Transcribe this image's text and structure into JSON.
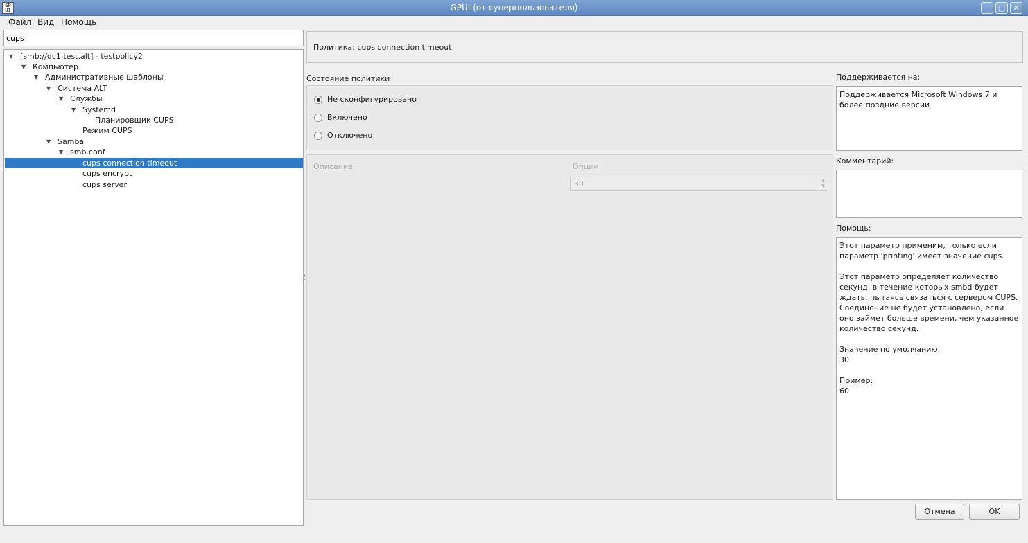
{
  "window": {
    "title": "GPUI (от суперпользователя)",
    "app_icon_text": "GP\nUI",
    "buttons": {
      "minimize": "_",
      "maximize": "□",
      "close": "✕"
    }
  },
  "menu": {
    "items": [
      {
        "first": "Ф",
        "rest": "айл"
      },
      {
        "first": "В",
        "rest": "ид"
      },
      {
        "first": "П",
        "rest": "омощь"
      }
    ]
  },
  "search": {
    "value": "cups"
  },
  "tree": {
    "rows": [
      {
        "label": "[smb://dc1.test.alt] - testpolicy2",
        "expanded": true
      },
      {
        "label": "Компьютер",
        "expanded": true
      },
      {
        "label": "Административные шаблоны",
        "expanded": true
      },
      {
        "label": "Система ALT",
        "expanded": true
      },
      {
        "label": "Службы",
        "expanded": true
      },
      {
        "label": "Systemd",
        "expanded": true
      },
      {
        "label": "Планировщик CUPS"
      },
      {
        "label": "Режим CUPS"
      },
      {
        "label": "Samba",
        "expanded": true
      },
      {
        "label": "smb.conf",
        "expanded": true
      },
      {
        "label": "cups connection timeout",
        "selected": true
      },
      {
        "label": "cups encrypt"
      },
      {
        "label": "cups server"
      }
    ]
  },
  "policy": {
    "header": "Политика: cups connection timeout",
    "state_label": "Состояние политики",
    "options": [
      {
        "label": "Не сконфигурировано",
        "checked": true
      },
      {
        "label": "Включено",
        "checked": false
      },
      {
        "label": "Отключено",
        "checked": false
      }
    ],
    "description_label": "Описание:",
    "options_label": "Опции:",
    "option_value": "30",
    "supported_label": "Поддерживается на:",
    "supported_text": "Поддерживается Microsoft Windows 7 и более поздние версии",
    "comment_label": "Комментарий:",
    "comment_value": "",
    "help_label": "Помощь:",
    "help_paragraphs": [
      "Этот параметр применим, только если параметр 'printing' имеет значение cups.",
      "Этот параметр определяет количество секунд, в течение которых smbd будет ждать, пытаясь связаться с сервером CUPS. Соединение не будет установлено, если оно займет больше времени, чем указанное количество секунд.",
      "Значение по умолчанию:\n30",
      "Пример:\n60"
    ]
  },
  "footer": {
    "cancel": {
      "first": "О",
      "rest": "тмена"
    },
    "ok": {
      "first": "O",
      "rest": "K"
    }
  }
}
